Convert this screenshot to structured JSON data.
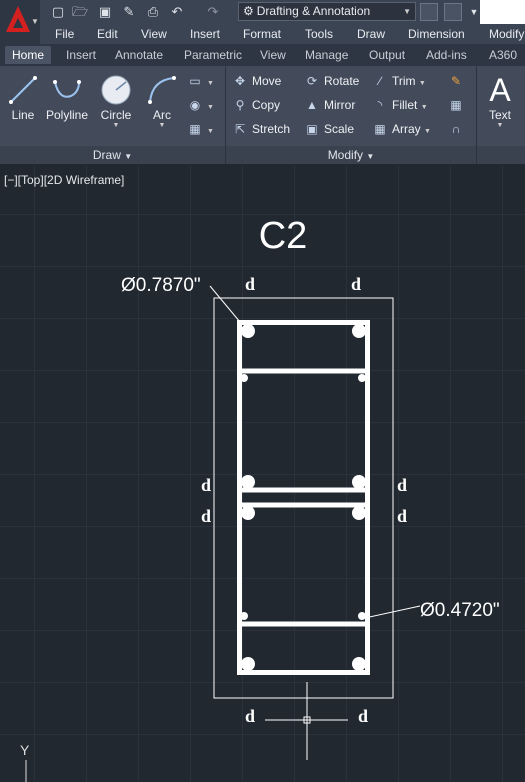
{
  "qat": {
    "workspace": "Drafting & Annotation",
    "icons": [
      "new-icon",
      "open-icon",
      "save-icon",
      "saveas-icon",
      "plot-icon",
      "undo-icon",
      "redo-icon"
    ]
  },
  "menu": [
    "File",
    "Edit",
    "View",
    "Insert",
    "Format",
    "Tools",
    "Draw",
    "Dimension",
    "Modify"
  ],
  "tabs": [
    "Home",
    "Insert",
    "Annotate",
    "Parametric",
    "View",
    "Manage",
    "Output",
    "Add-ins",
    "A360"
  ],
  "ribbon": {
    "draw": {
      "title": "Draw",
      "tools": [
        "Line",
        "Polyline",
        "Circle",
        "Arc"
      ]
    },
    "modify": {
      "title": "Modify",
      "col1": [
        "Move",
        "Copy",
        "Stretch"
      ],
      "col2": [
        "Rotate",
        "Mirror",
        "Scale"
      ],
      "col3": [
        "Trim",
        "Fillet",
        "Array"
      ]
    },
    "text_tool": "Text",
    "accent": "#d52020"
  },
  "viewport": {
    "label": "[−][Top][2D Wireframe]"
  },
  "drawing": {
    "title": "C2",
    "dim_top": "Ø0.7870\"",
    "dim_bottom": "Ø0.4720\"",
    "marker": "d",
    "ucs_y": "Y"
  }
}
